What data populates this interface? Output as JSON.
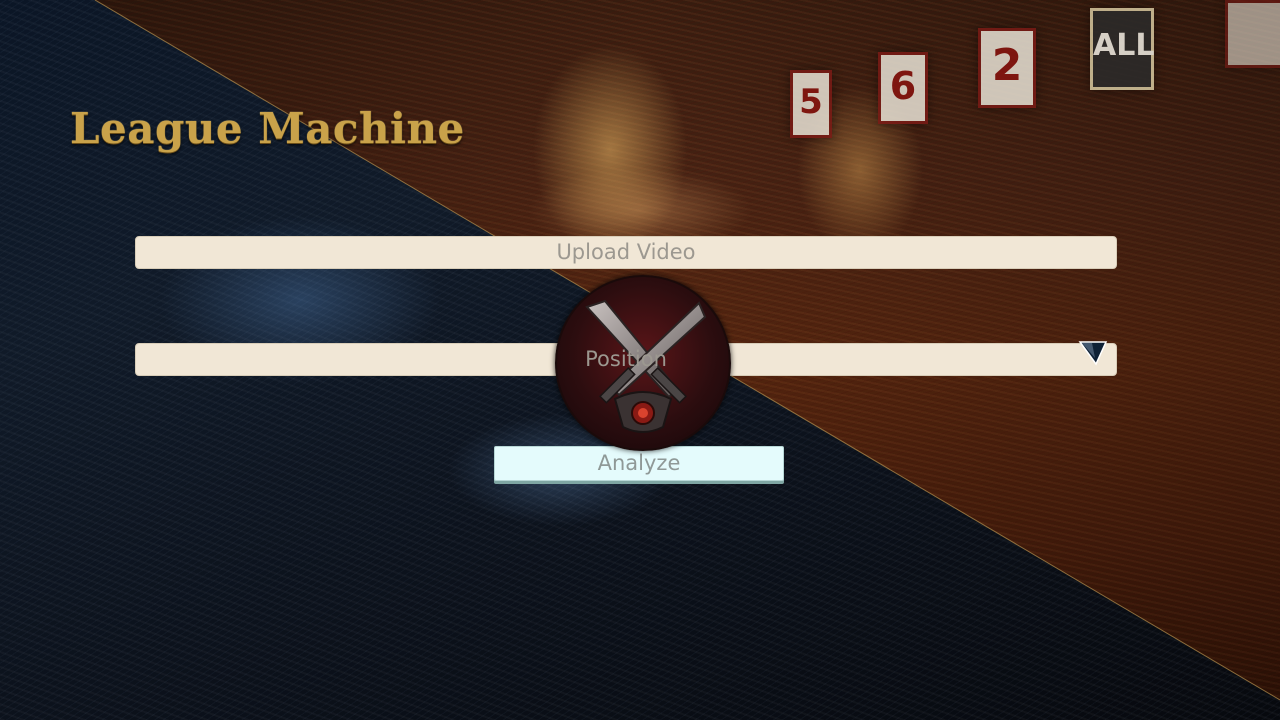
{
  "app": {
    "title": "League Machine"
  },
  "form": {
    "upload_label": "Upload Video",
    "position_placeholder": "Position",
    "analyze_label": "Analyze"
  },
  "icons": {
    "emblem": "crossed-swords-emblem-icon",
    "dropdown": "dropdown-arrow-icon"
  },
  "colors": {
    "title_gold": "#c9a24a",
    "field_bg": "#f1e7d6",
    "button_bg": "#e4fbfc",
    "placeholder_text": "#9c9890"
  }
}
